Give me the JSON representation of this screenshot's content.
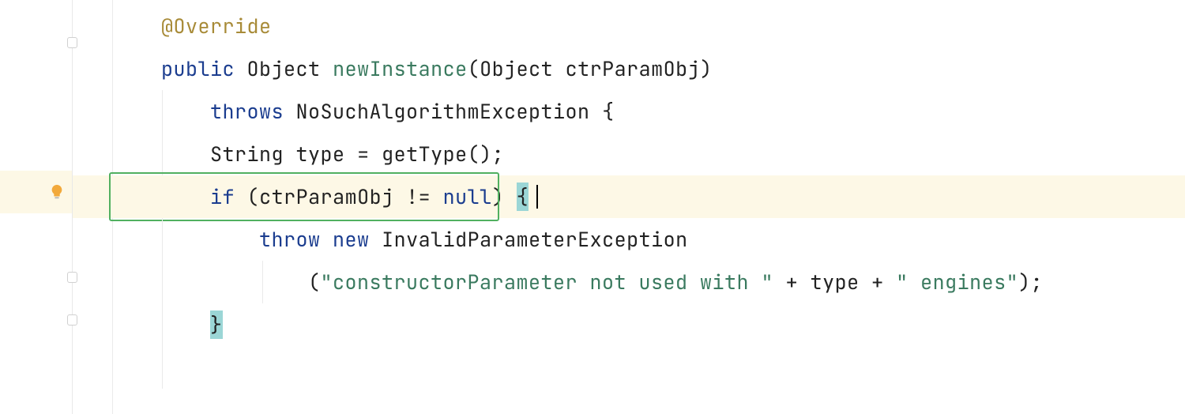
{
  "code": {
    "annotation": "@Override",
    "kw_public": "public",
    "type_object": "Object",
    "method_name": "newInstance",
    "lparen": "(",
    "param_type": "Object",
    "param_name": "ctrParamObj",
    "rparen": ")",
    "kw_throws": "throws",
    "exc1": "NoSuchAlgorithmException",
    "lbrace": "{",
    "var_decl_type": "String",
    "var_name": "type",
    "equals": "=",
    "gettype_call": "getType();",
    "kw_if": "if",
    "cond_open": "(",
    "cond_var": "ctrParamObj",
    "cond_op": "!=",
    "kw_null": "null",
    "cond_close": ")",
    "if_lbrace": "{",
    "kw_throw": "throw",
    "kw_new": "new",
    "exc2": "InvalidParameterException",
    "str_open": "(",
    "str1": "\"constructorParameter not used with \"",
    "plus": "+",
    "str_var": "type",
    "str2": "\" engines\"",
    "str_close": ");",
    "rbrace": "}"
  }
}
